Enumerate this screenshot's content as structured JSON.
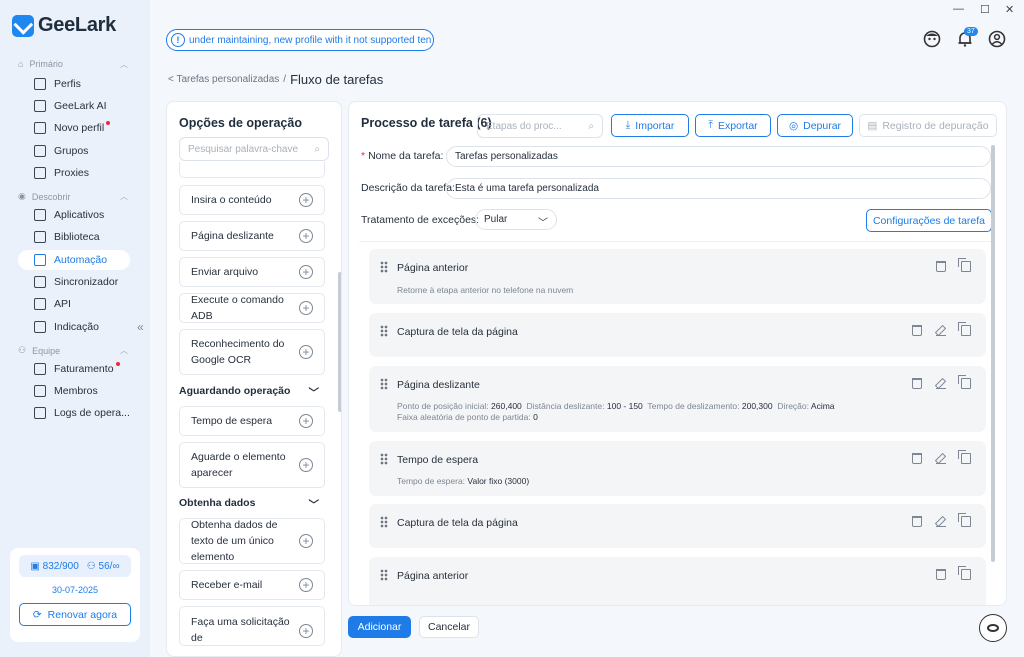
{
  "app": {
    "name": "GeeLark"
  },
  "notice": {
    "text": "under maintaining, new profile with it not supported ten"
  },
  "header": {
    "notification_count": "37"
  },
  "breadcrumb": {
    "parent": "< Tarefas personalizadas",
    "sep": "/",
    "current": "Fluxo de tarefas"
  },
  "sidebar": {
    "sections": [
      {
        "label": "Primário"
      },
      {
        "label": "Descobrir"
      },
      {
        "label": "Equipe"
      }
    ],
    "items": [
      {
        "label": "Perfis",
        "icon": "profiles-icon"
      },
      {
        "label": "GeeLark AI",
        "icon": "ai-icon"
      },
      {
        "label": "Novo perfil",
        "icon": "new-profile-icon",
        "dot": true
      },
      {
        "label": "Grupos",
        "icon": "list-icon"
      },
      {
        "label": "Proxies",
        "icon": "proxy-icon"
      },
      {
        "label": "Aplicativos",
        "icon": "apps-icon"
      },
      {
        "label": "Biblioteca",
        "icon": "library-icon"
      },
      {
        "label": "Automação",
        "icon": "automation-icon",
        "active": true
      },
      {
        "label": "Sincronizador",
        "icon": "sync-icon"
      },
      {
        "label": "API",
        "icon": "api-icon"
      },
      {
        "label": "Indicação",
        "icon": "dollar-icon"
      },
      {
        "label": "Faturamento",
        "icon": "billing-icon",
        "dot": true
      },
      {
        "label": "Membros",
        "icon": "member-icon"
      },
      {
        "label": "Logs de opera...",
        "icon": "logs-icon"
      }
    ],
    "collapse": "«",
    "quota": {
      "profiles": "832/900",
      "members": "56/∞",
      "date": "30-07-2025",
      "renew": "Renovar agora"
    }
  },
  "ops": {
    "title": "Opções de operação",
    "search_placeholder": "Pesquisar palavra-chave",
    "items": [
      "Insira o conteúdo",
      "Página deslizante",
      "Enviar arquivo",
      "Execute o comando ADB",
      "Reconhecimento do Google OCR",
      "Tempo de espera",
      "Aguarde o elemento aparecer",
      "Obtenha dados de texto de um único elemento",
      "Receber e-mail",
      "Faça uma solicitação de"
    ],
    "groups": [
      "Aguardando operação",
      "Obtenha dados"
    ]
  },
  "main": {
    "title": "Processo de tarefa (6)",
    "step_search_placeholder": "Etapas do proc...",
    "buttons": {
      "import": "Importar",
      "export": "Exportar",
      "debug": "Depurar",
      "debug_log": "Registro de depuração"
    },
    "name_label": "Nome da tarefa:",
    "name_value": "Tarefas personalizadas",
    "desc_label": "Descrição da tarefa:",
    "desc_value": "Esta é uma tarefa personalizada",
    "exception_label": "Tratamento de exceções:",
    "exception_value": "Pular",
    "settings_button": "Configurações de tarefa",
    "steps": [
      {
        "name": "Página anterior",
        "desc": "Retorne à etapa anterior no telefone na nuvem"
      },
      {
        "name": "Captura de tela da página"
      },
      {
        "name": "Página deslizante",
        "desc_line1": [
          [
            "Ponto de posição inicial:",
            "260,400"
          ],
          [
            "Distância deslizante:",
            "100 - 150"
          ],
          [
            "Tempo de deslizamento:",
            "200,300"
          ],
          [
            "Direção:",
            "Acima"
          ]
        ],
        "desc_line2": [
          [
            "Faixa aleatória de ponto de partida:",
            "0"
          ]
        ]
      },
      {
        "name": "Tempo de espera",
        "desc_label": "Tempo de espera:",
        "desc_value": "Valor fixo (3000)"
      },
      {
        "name": "Captura de tela da página"
      },
      {
        "name": "Página anterior"
      }
    ]
  },
  "footer": {
    "add": "Adicionar",
    "cancel": "Cancelar"
  }
}
